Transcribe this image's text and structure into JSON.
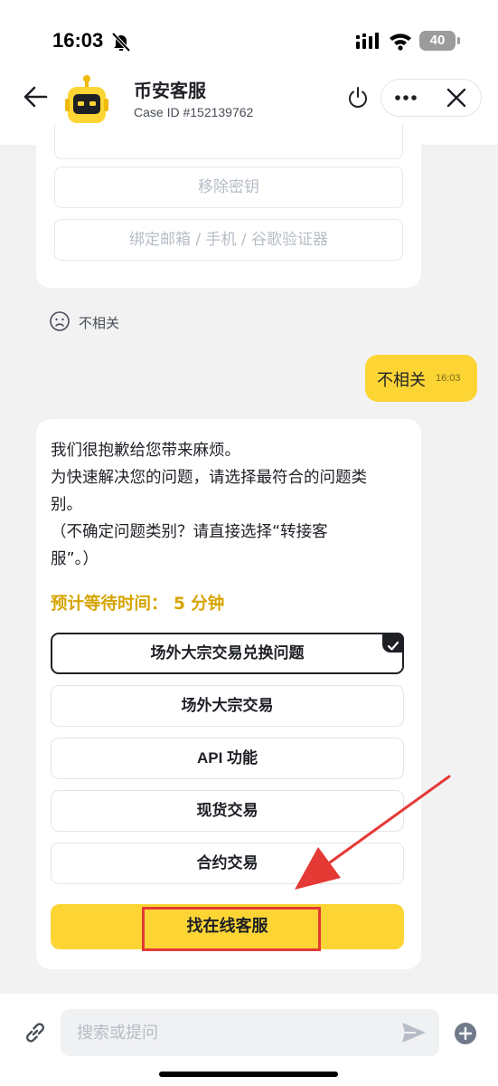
{
  "status_bar": {
    "time": "16:03",
    "battery": "40"
  },
  "header": {
    "title": "币安客服",
    "subtitle": "Case ID #152139762"
  },
  "previous_options": [
    "移除密钥",
    "绑定邮箱 / 手机 / 谷歌验证器"
  ],
  "feedback": {
    "label": "不相关"
  },
  "user_message": {
    "text": "不相关",
    "time": "16:03"
  },
  "bot_message": {
    "lines": [
      "我们很抱歉给您带来麻烦。",
      "为快速解决您的问题，请选择最符合的问题类",
      "别。",
      "（不确定问题类别？请直接选择“转接客",
      "服”。）"
    ],
    "wait_time": "预计等待时间： 5 分钟",
    "options": [
      {
        "label": "场外大宗交易兑换问题",
        "selected": true
      },
      {
        "label": "场外大宗交易",
        "selected": false
      },
      {
        "label": "API 功能",
        "selected": false
      },
      {
        "label": "现货交易",
        "selected": false
      },
      {
        "label": "合约交易",
        "selected": false
      }
    ],
    "cta_label": "找在线客服"
  },
  "composer": {
    "placeholder": "搜索或提问"
  },
  "colors": {
    "accent": "#fcd535",
    "annotation": "#e53935",
    "wait_text": "#d6a400"
  },
  "icons": [
    "bell-off-icon",
    "signal-icon",
    "wifi-icon",
    "back-arrow-icon",
    "bot-avatar-icon",
    "power-icon",
    "more-icon",
    "close-icon",
    "sad-face-icon",
    "check-icon",
    "link-icon",
    "send-icon",
    "plus-icon"
  ]
}
